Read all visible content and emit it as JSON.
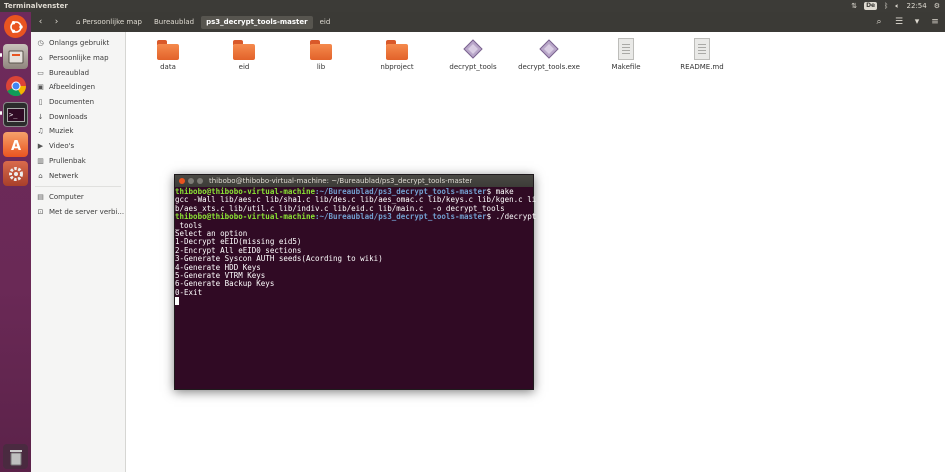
{
  "topbar": {
    "title": "Terminalvenster",
    "keyboard": "De",
    "volume_icon": "speaker-icon",
    "time": "22:54"
  },
  "launcher": {
    "items": [
      {
        "name": "dash-home",
        "color": "#e95420"
      },
      {
        "name": "files",
        "color": "#a0958e"
      },
      {
        "name": "chrome",
        "color": "#4285f4"
      },
      {
        "name": "terminal",
        "color": "#2c2c2c"
      },
      {
        "name": "software-center",
        "color": "#e95420"
      },
      {
        "name": "settings",
        "color": "#c8543a"
      },
      {
        "name": "trash",
        "color": "#8f8f8f"
      }
    ]
  },
  "header": {
    "crumbs": [
      "Persoonlijke map",
      "Bureaublad",
      "ps3_decrypt_tools-master",
      "eid"
    ],
    "active_index": 2
  },
  "sidebar": {
    "items": [
      {
        "label": "Onlangs gebruikt",
        "icon": "◷"
      },
      {
        "label": "Persoonlijke map",
        "icon": "⌂"
      },
      {
        "label": "Bureaublad",
        "icon": "▭"
      },
      {
        "label": "Afbeeldingen",
        "icon": "▣"
      },
      {
        "label": "Documenten",
        "icon": "▯"
      },
      {
        "label": "Downloads",
        "icon": "↓"
      },
      {
        "label": "Muziek",
        "icon": "♫"
      },
      {
        "label": "Video's",
        "icon": "▶"
      },
      {
        "label": "Prullenbak",
        "icon": "▥"
      },
      {
        "label": "Netwerk",
        "icon": "⌂"
      }
    ],
    "devices": [
      {
        "label": "Computer",
        "icon": "▤"
      },
      {
        "label": "Met de server verbi...",
        "icon": "⊡"
      }
    ]
  },
  "files": [
    {
      "name": "data",
      "type": "folder"
    },
    {
      "name": "eid",
      "type": "folder"
    },
    {
      "name": "lib",
      "type": "folder"
    },
    {
      "name": "nbproject",
      "type": "folder"
    },
    {
      "name": "decrypt_tools",
      "type": "exec"
    },
    {
      "name": "decrypt_tools.exe",
      "type": "exec"
    },
    {
      "name": "Makefile",
      "type": "doc"
    },
    {
      "name": "README.md",
      "type": "doc"
    }
  ],
  "terminal": {
    "title": "thibobo@thibobo-virtual-machine: ~/Bureaublad/ps3_decrypt_tools-master",
    "user_host": "thibobo@thibobo-virtual-machine",
    "path": ":~/Bureaublad/ps3_decrypt_tools-master",
    "cmd1": "$ make",
    "gcc_lines": [
      "gcc -Wall lib/aes.c lib/sha1.c lib/des.c lib/aes_omac.c lib/keys.c lib/kgen.c li",
      "b/aes_xts.c lib/util.c lib/indiv.c lib/eid.c lib/main.c  -o decrypt_tools"
    ],
    "cmd2a": "$ ./decrypt",
    "cmd2b": "_tools",
    "output": [
      "Select an option",
      "1-Decrypt eEID(missing eid5)",
      "2-Encrypt All eEID0 sections",
      "3-Generate Syscon AUTH seeds(Acording to wiki)",
      "4-Generate HDD Keys",
      "5-Generate VTRM Keys",
      "6-Generate Backup Keys",
      "0-Exit"
    ]
  }
}
